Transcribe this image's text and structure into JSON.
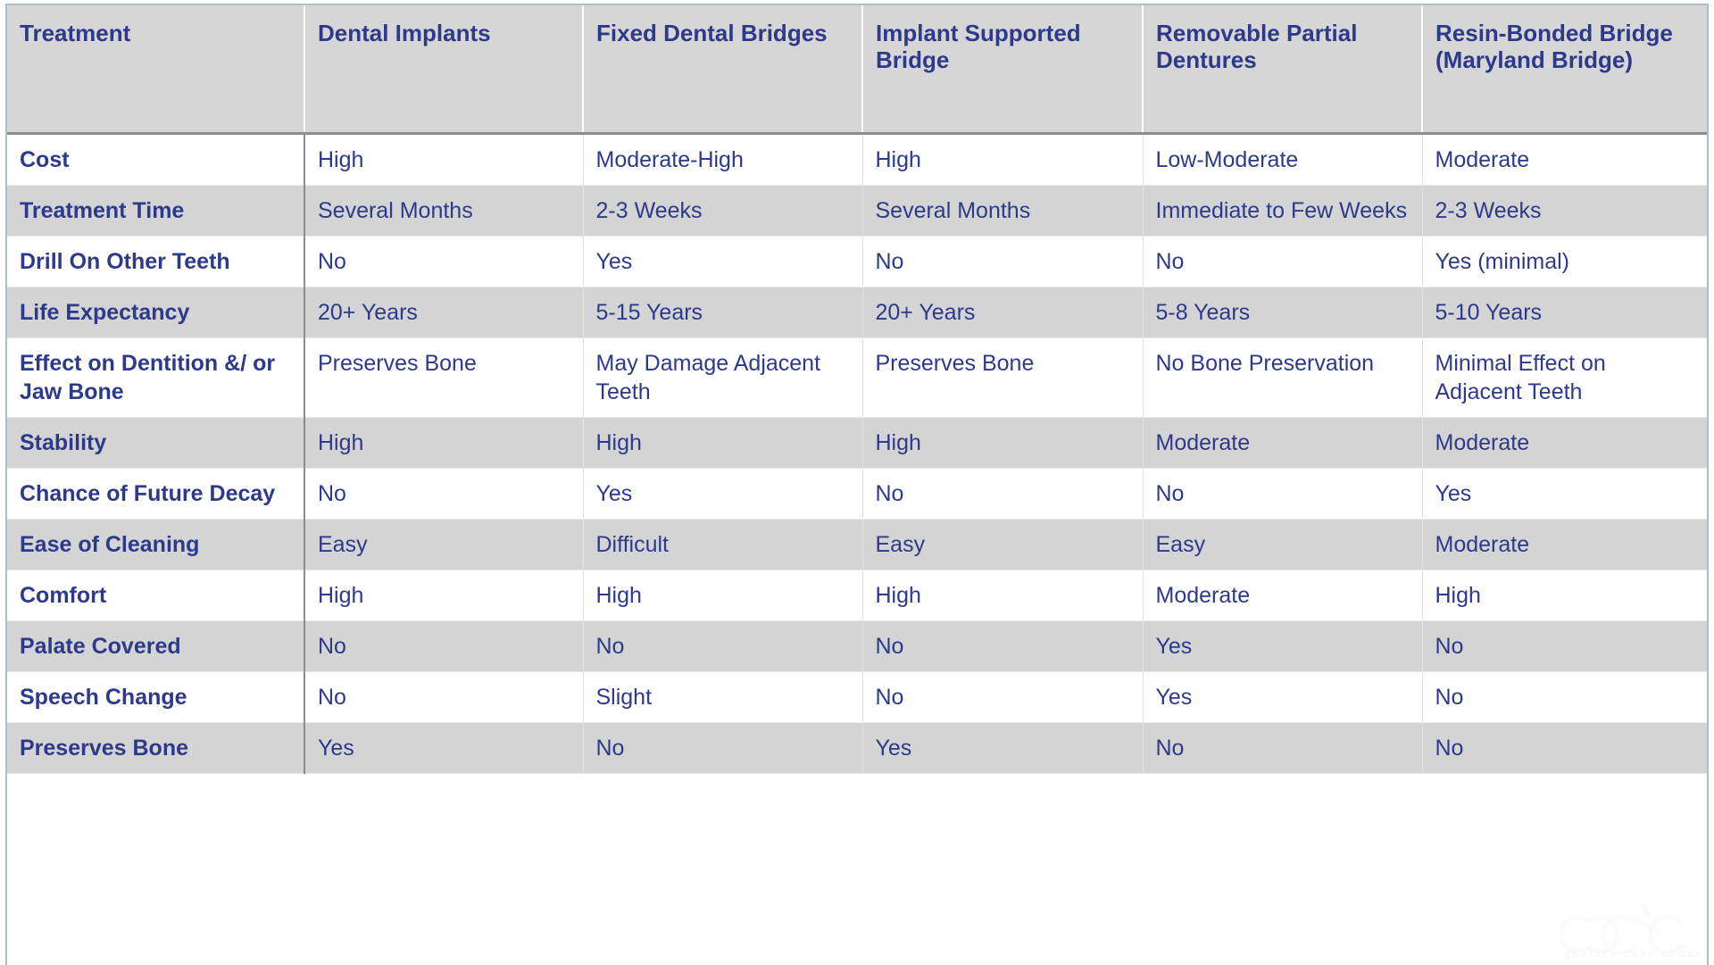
{
  "table": {
    "columns": [
      "Treatment",
      "Dental Implants",
      "Fixed Dental Bridges",
      "Implant Supported Bridge",
      "Removable Partial Dentures",
      "Resin-Bonded Bridge (Maryland Bridge)"
    ],
    "rows": [
      {
        "label": "Cost",
        "cells": [
          "High",
          "Moderate-High",
          "High",
          "Low-Moderate",
          "Moderate"
        ]
      },
      {
        "label": "Treatment Time",
        "cells": [
          "Several Months",
          "2-3 Weeks",
          "Several Months",
          "Immediate to Few Weeks",
          "2-3 Weeks"
        ]
      },
      {
        "label": "Drill On Other Teeth",
        "cells": [
          "No",
          "Yes",
          "No",
          "No",
          "Yes (minimal)"
        ]
      },
      {
        "label": "Life Expectancy",
        "cells": [
          "20+ Years",
          "5-15 Years",
          "20+ Years",
          "5-8 Years",
          "5-10 Years"
        ]
      },
      {
        "label": "Effect on Dentition &/ or Jaw Bone",
        "cells": [
          "Preserves Bone",
          "May Damage Adjacent Teeth",
          "Preserves Bone",
          "No Bone Preservation",
          "Minimal Effect on Adjacent Teeth"
        ]
      },
      {
        "label": "Stability",
        "cells": [
          "High",
          "High",
          "High",
          "Moderate",
          "Moderate"
        ]
      },
      {
        "label": "Chance of Future Decay",
        "cells": [
          "No",
          "Yes",
          "No",
          "No",
          "Yes"
        ]
      },
      {
        "label": "Ease of Cleaning",
        "cells": [
          "Easy",
          "Difficult",
          "Easy",
          "Easy",
          "Moderate"
        ]
      },
      {
        "label": "Comfort",
        "cells": [
          "High",
          "High",
          "High",
          "Moderate",
          "High"
        ]
      },
      {
        "label": "Palate Covered",
        "cells": [
          "No",
          "No",
          "No",
          "Yes",
          "No"
        ]
      },
      {
        "label": "Speech Change",
        "cells": [
          "No",
          "Slight",
          "No",
          "Yes",
          "No"
        ]
      },
      {
        "label": "Preserves Bone",
        "cells": [
          "Yes",
          "No",
          "Yes",
          "No",
          "No"
        ]
      }
    ]
  },
  "watermark": {
    "mark": "QCG",
    "tagline": "QUALITY CARE GLOBAL"
  },
  "colors": {
    "text_navy": "#2d3a8c",
    "header_bg": "#d6d6d6",
    "row_alt_bg": "#d4d4d4",
    "row_bg": "#ffffff",
    "outer_border": "#a9c0d0",
    "label_divider": "#8c8c8c"
  }
}
